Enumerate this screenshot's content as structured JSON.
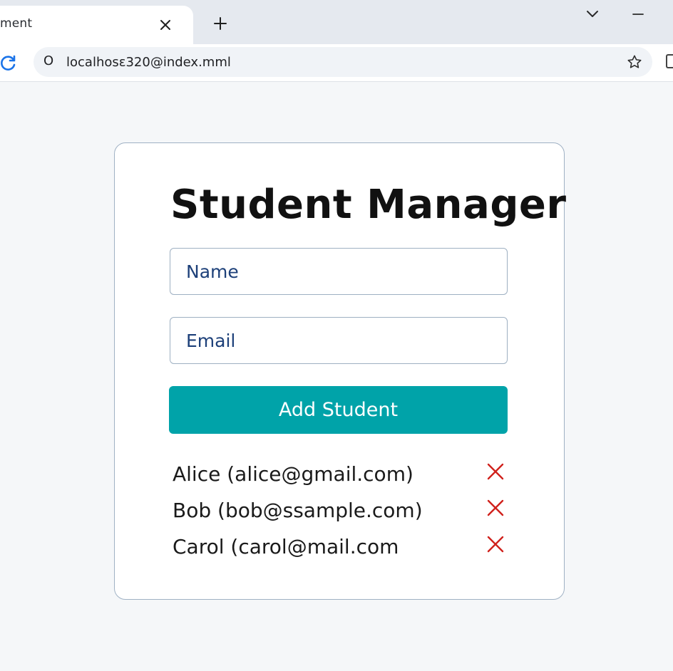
{
  "browser": {
    "tab_title": "ment",
    "url": "localhosε320@index.mml",
    "site_info_glyph": "O",
    "icons": {
      "tab_close": "close-icon",
      "new_tab": "plus-icon",
      "tab_search": "chevron-down-icon",
      "minimize": "minimize-icon",
      "reload": "reload-icon",
      "bookmark": "star-icon"
    }
  },
  "app": {
    "title": "Student Manager",
    "name_placeholder": "Name",
    "email_placeholder": "Email",
    "add_button_label": "Add Student",
    "students": [
      {
        "label": "Alice (alice@gmail.com)"
      },
      {
        "label": "Bob (bob@ssample.com)"
      },
      {
        "label": "Carol (carol@mail.com"
      }
    ],
    "remove_icon": "close-icon"
  },
  "colors": {
    "accent": "#00a3a9",
    "remove": "#d0211c",
    "placeholder_text": "#1d4079",
    "card_border": "#9fb1c4"
  }
}
